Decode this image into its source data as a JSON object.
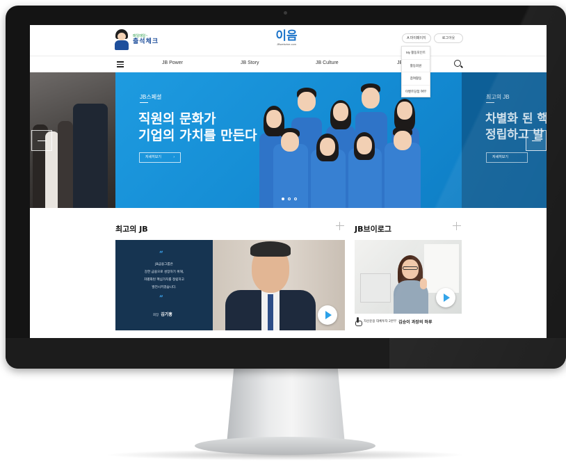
{
  "header": {
    "attendance_sub": "매일매일~",
    "attendance_main": "출석체크",
    "logo_main": "이음",
    "logo_url": "JBwebzine.com",
    "mypage_label": "A 마이페이지",
    "logout_label": "로그아웃"
  },
  "nav": {
    "items": [
      "JB Power",
      "JB Story",
      "JB Culture",
      "JE"
    ]
  },
  "dropdown": {
    "items": [
      "My 활동포인트",
      "활동회원",
      "참여활동",
      "이벤트당첨 여부"
    ]
  },
  "hero": {
    "eyebrow": "JB스페셜",
    "title_line1": "직원의 문화가",
    "title_line2": "기업의 가치를 만든다",
    "button_label": "자세히보기",
    "next_eyebrow": "최고의 JB",
    "next_title_line1": "차별화 된 핵",
    "next_title_line2": "정립하고 발",
    "next_button_label": "자세히보기",
    "slide_count": 3,
    "active_slide": 1
  },
  "sections": {
    "best_title": "최고의 JB",
    "vlog_title": "JB브이로그"
  },
  "best_card": {
    "quote_open": "“",
    "quote_close": "”",
    "quote_lines": [
      "JB금융그룹은",
      "강한 금융으로 성장하기 위해,",
      "차별화된 핵심가치를 정립하고",
      "발전시키겠습니다."
    ],
    "sig_role": "회장",
    "sig_name": "김기홍"
  },
  "vlog_card": {
    "caption_sub": "자산운용 대체투자 2본부",
    "caption_main": "김승이 과장의 하루"
  },
  "colors": {
    "hero_blue": "#1b8fd6",
    "brand_blue": "#1a73c9",
    "brand_orange": "#f1a21b",
    "quote_bg": "#163451",
    "play_accent": "#2aa0e8"
  }
}
